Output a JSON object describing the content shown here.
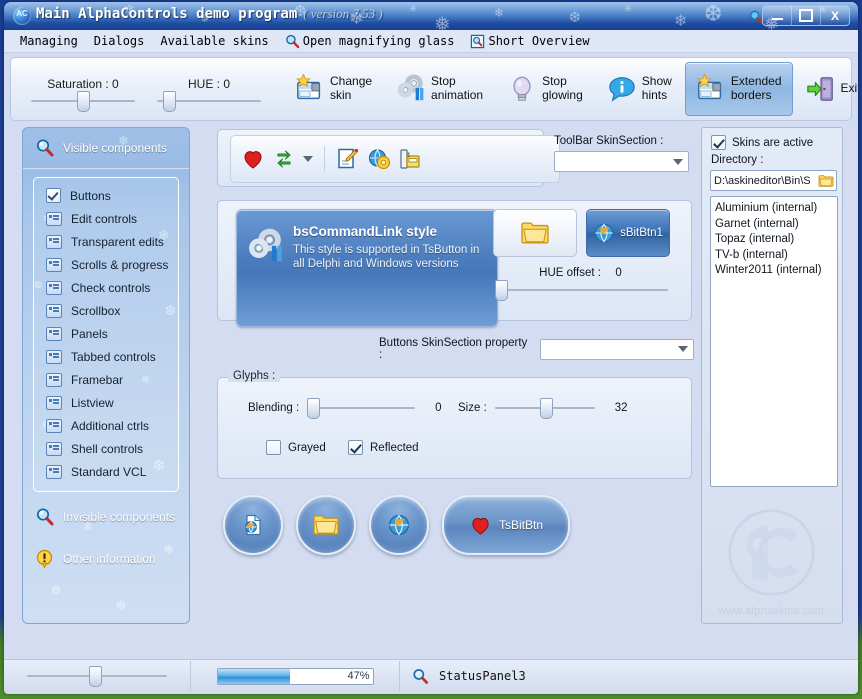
{
  "window": {
    "title": "Main AlphaControls demo program",
    "version": "( version 7.53 )",
    "app_icon": "alphacontrols-logo-icon",
    "titlebar_magnifier": "magnifier-icon",
    "buttons": {
      "minimize": "minimize-icon",
      "maximize": "maximize-icon",
      "close": "X"
    }
  },
  "menubar": {
    "items": [
      {
        "label": "Managing",
        "icon": ""
      },
      {
        "label": "Dialogs",
        "icon": ""
      },
      {
        "label": "Available skins",
        "icon": ""
      },
      {
        "label": "Open magnifying glass",
        "icon": "magnifier-icon"
      },
      {
        "label": "Short Overview",
        "icon": "document-magnifier-icon"
      }
    ]
  },
  "toolbar": {
    "sliders": [
      {
        "label": "Saturation : 0",
        "value": 0,
        "thumb_pct": 48
      },
      {
        "label": "HUE : 0",
        "value": 0,
        "thumb_pct": 10
      }
    ],
    "buttons": [
      {
        "label": "Change\nskin",
        "icon": "change-skin-icon",
        "active": false
      },
      {
        "label": "Stop\nanimation",
        "icon": "gears-icon",
        "active": false
      },
      {
        "label": "Stop\nglowing",
        "icon": "lightbulb-icon",
        "active": false
      },
      {
        "label": "Show\nhints",
        "icon": "info-balloon-icon",
        "active": false
      },
      {
        "label": "Extended\nborders",
        "icon": "change-skin-icon",
        "active": true
      }
    ],
    "exit": {
      "label": "Exit",
      "icon": "exit-door-icon"
    }
  },
  "sidebar": {
    "header": {
      "label": "Visible components",
      "icon": "magnifier-icon"
    },
    "items": [
      {
        "label": "Buttons",
        "icon": "checkbox-checked-icon",
        "selected": true
      },
      {
        "label": "Edit controls",
        "icon": "edit-control-icon",
        "selected": false
      },
      {
        "label": "Transparent edits",
        "icon": "edit-control-icon",
        "selected": false
      },
      {
        "label": "Scrolls & progress",
        "icon": "edit-control-icon",
        "selected": false
      },
      {
        "label": "Check controls",
        "icon": "edit-control-icon",
        "selected": false
      },
      {
        "label": "Scrollbox",
        "icon": "edit-control-icon",
        "selected": false
      },
      {
        "label": "Panels",
        "icon": "edit-control-icon",
        "selected": false
      },
      {
        "label": "Tabbed controls",
        "icon": "edit-control-icon",
        "selected": false
      },
      {
        "label": "Framebar",
        "icon": "edit-control-icon",
        "selected": false
      },
      {
        "label": "Listview",
        "icon": "edit-control-icon",
        "selected": false
      },
      {
        "label": "Additional ctrls",
        "icon": "edit-control-icon",
        "selected": false
      },
      {
        "label": "Shell controls",
        "icon": "edit-control-icon",
        "selected": false
      },
      {
        "label": "Standard VCL",
        "icon": "edit-control-icon",
        "selected": false
      }
    ],
    "footer": [
      {
        "label": "Invisible components",
        "icon": "magnifier-icon"
      },
      {
        "label": "Other information",
        "icon": "warning-icon"
      }
    ]
  },
  "main": {
    "mini_toolbar": {
      "icons": [
        "heart-icon",
        "refresh-arrows-icon",
        "dropdown-caret-icon",
        "edit-note-icon",
        "globe-gear-icon",
        "fax-printer-icon"
      ]
    },
    "toolbar_skinsection": {
      "label": "ToolBar SkinSection :",
      "value": "",
      "caret": "dropdown-caret-icon"
    },
    "command_link": {
      "title": "bsCommandLink style",
      "description": "This style is supported in TsButton in\nall Delphi and Windows versions",
      "icon": "gears-icon"
    },
    "folder_button": {
      "icon": "folder-icon",
      "label": ""
    },
    "sbitbtn": {
      "label": "sBitBtn1",
      "icon": "globe-icon"
    },
    "hue_offset": {
      "label": "HUE offset :",
      "value": "0",
      "thumb_pct": 2
    },
    "buttons_skinsection": {
      "label": "Buttons SkinSection property :",
      "value": "",
      "caret": "dropdown-caret-icon"
    },
    "glyphs": {
      "title": "Glyphs :",
      "blending": {
        "label": "Blending :",
        "value": "0",
        "thumb_pct": 2
      },
      "size": {
        "label": "Size :",
        "value": "32",
        "thumb_pct": 50
      },
      "grayed": {
        "label": "Grayed",
        "checked": false
      },
      "reflected": {
        "label": "Reflected",
        "checked": true
      }
    },
    "bottom_buttons": [
      {
        "shape": "round",
        "icon": "web-document-icon",
        "label": ""
      },
      {
        "shape": "round",
        "icon": "folder-icon",
        "label": ""
      },
      {
        "shape": "round",
        "icon": "globe-icon",
        "label": ""
      },
      {
        "shape": "pill",
        "icon": "heart-icon",
        "label": "TsBitBtn"
      }
    ]
  },
  "right_panel": {
    "skins_active": {
      "label": "Skins are active",
      "checked": true
    },
    "directory_label": "Directory :",
    "directory_value": "D:\\askineditor\\Bin\\S",
    "directory_icon": "folder-open-icon",
    "skins": [
      "Aluminium (internal)",
      "Garnet (internal)",
      "Topaz (internal)",
      "TV-b (internal)",
      "Winter2011 (internal)"
    ],
    "watermark": {
      "text": "www.alphaskins.com",
      "logo": "ac-logo-icon"
    }
  },
  "statusbar": {
    "slider": {
      "thumb_pct": 48
    },
    "progress": {
      "percent": 47,
      "label": "47%"
    },
    "icon": "magnifier-icon",
    "panel_text": "StatusPanel3"
  },
  "colors": {
    "background": "#d3dcf0",
    "titlebar": "#1f4fa4",
    "accent": "#4b7cbd",
    "progress": "#2d90d8"
  }
}
